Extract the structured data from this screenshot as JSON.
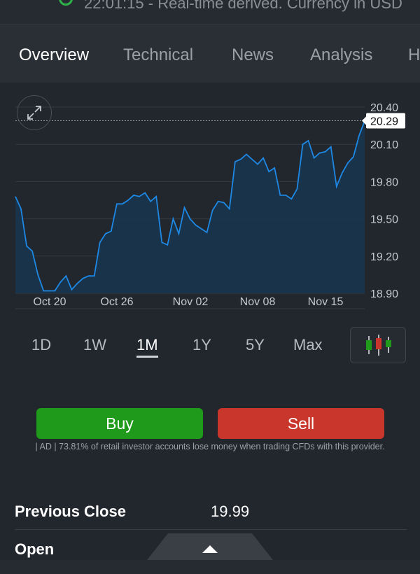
{
  "status": {
    "text": "22:01:15 - Real-time derived. Currency in USD"
  },
  "tabs": [
    {
      "label": "Overview",
      "active": true
    },
    {
      "label": "Technical",
      "active": false
    },
    {
      "label": "News",
      "active": false
    },
    {
      "label": "Analysis",
      "active": false
    },
    {
      "label": "H",
      "active": false
    }
  ],
  "chart_data": {
    "type": "area",
    "current_price": "20.29",
    "current_value": 20.29,
    "ylim": [
      18.9,
      20.4
    ],
    "y_ticks": [
      "20.40",
      "20.10",
      "19.80",
      "19.50",
      "19.20",
      "18.90"
    ],
    "x_ticks": [
      "Oct 20",
      "Oct 26",
      "Nov 02",
      "Nov 08",
      "Nov 15"
    ],
    "series": [
      {
        "values": [
          19.68,
          19.58,
          19.28,
          19.24,
          19.05,
          18.92,
          18.92,
          18.92,
          18.99,
          19.04,
          18.93,
          18.98,
          19.02,
          19.04,
          19.04,
          19.31,
          19.38,
          19.4,
          19.62,
          19.62,
          19.65,
          19.69,
          19.68,
          19.71,
          19.64,
          19.68,
          19.31,
          19.29,
          19.5,
          19.38,
          19.59,
          19.5,
          19.45,
          19.42,
          19.39,
          19.57,
          19.64,
          19.63,
          19.58,
          19.96,
          19.98,
          20.02,
          19.98,
          19.94,
          19.99,
          19.88,
          19.91,
          19.69,
          19.69,
          19.66,
          19.74,
          20.1,
          20.13,
          19.99,
          20.03,
          20.04,
          20.08,
          19.76,
          19.87,
          19.95,
          20.0,
          20.17,
          20.29
        ]
      }
    ],
    "colors": {
      "line": "#1e88e5",
      "fill": "#163650"
    }
  },
  "ranges": {
    "items": [
      {
        "label": "1D",
        "active": false
      },
      {
        "label": "1W",
        "active": false
      },
      {
        "label": "1M",
        "active": true
      },
      {
        "label": "1Y",
        "active": false
      },
      {
        "label": "5Y",
        "active": false
      },
      {
        "label": "Max",
        "active": false
      }
    ],
    "candle_icon": "candlestick-chart-icon"
  },
  "trade": {
    "buy_label": "Buy",
    "sell_label": "Sell",
    "disclaimer": "| AD | 73.81% of retail investor accounts lose money when trading CFDs with this provider."
  },
  "stats": [
    {
      "label": "Previous Close",
      "value": "19.99"
    },
    {
      "label": "Open",
      "value": ""
    }
  ],
  "colors": {
    "buy": "#1f9a1b",
    "sell": "#c9372c",
    "background": "#22262d"
  }
}
